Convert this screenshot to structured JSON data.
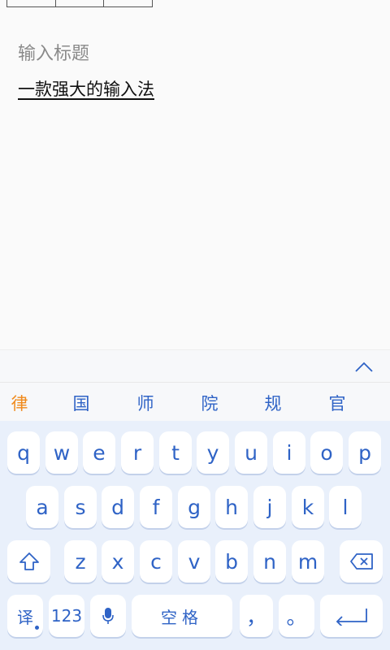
{
  "editor": {
    "title_placeholder": "输入标题",
    "body_text": "一款强大的输入法"
  },
  "keyboard": {
    "collapse_icon": "chevron-up-icon",
    "candidates": [
      "律",
      "国",
      "师",
      "院",
      "规",
      "官"
    ],
    "row1": [
      "q",
      "w",
      "e",
      "r",
      "t",
      "y",
      "u",
      "i",
      "o",
      "p"
    ],
    "row2": [
      "a",
      "s",
      "d",
      "f",
      "g",
      "h",
      "j",
      "k",
      "l"
    ],
    "row3": [
      "z",
      "x",
      "c",
      "v",
      "b",
      "n",
      "m"
    ],
    "shift_icon": "shift-icon",
    "backspace_icon": "backspace-icon",
    "translate_label": "译",
    "numbers_label": "123",
    "mic_icon": "microphone-icon",
    "space_label": "空格",
    "comma_label": "，",
    "period_label": "。",
    "enter_icon": "enter-icon",
    "colors": {
      "key_text": "#2f63c6",
      "highlight_candidate": "#f08a1c",
      "keyboard_bg": "#e9f0fb"
    }
  }
}
